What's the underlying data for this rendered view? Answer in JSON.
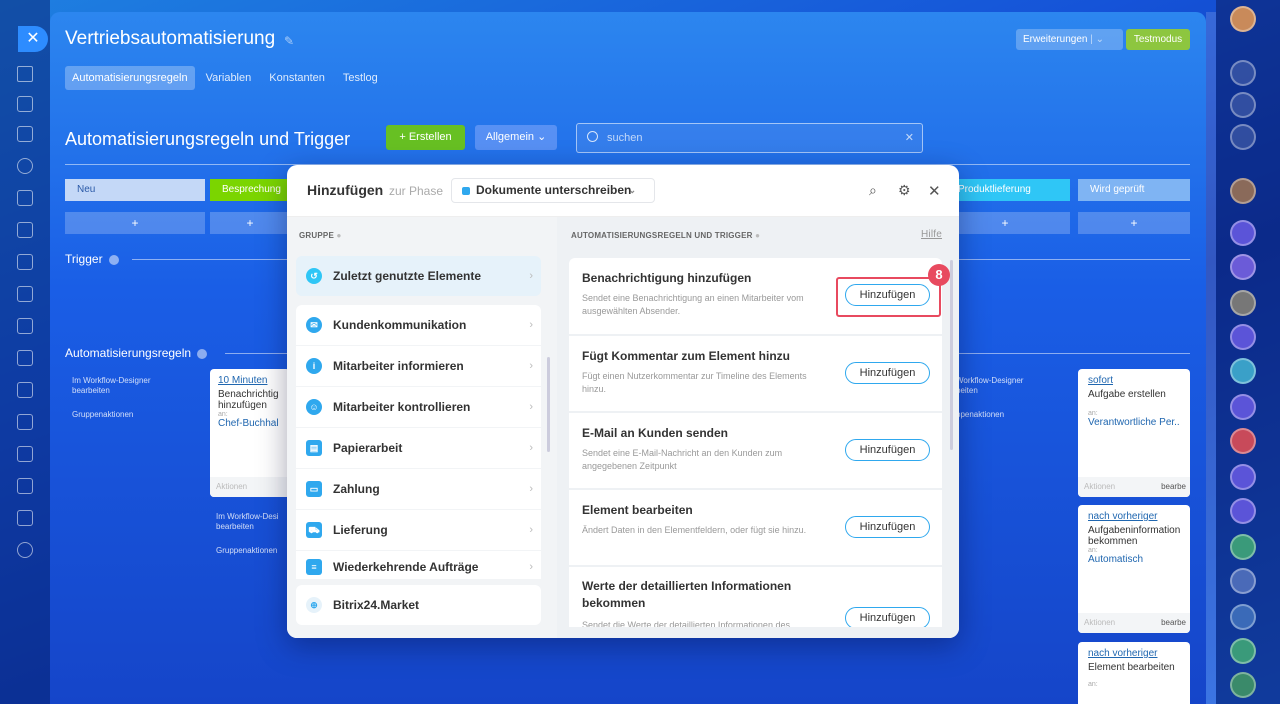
{
  "app": {
    "title": "Vertriebsautomatisierung",
    "erweiterungen": "Erweiterungen",
    "testmodus": "Testmodus"
  },
  "tabs": [
    "Automatisierungsregeln",
    "Variablen",
    "Konstanten",
    "Testlog"
  ],
  "section": {
    "title": "Automatisierungsregeln und Trigger",
    "create": "+ Erstellen",
    "allgemein": "Allgemein",
    "search_placeholder": "suchen"
  },
  "stages": [
    {
      "label": "Neu",
      "color": "#c4d8f7"
    },
    {
      "label": "Besprechung",
      "color": "#7bd500"
    },
    {
      "label": "Produktlieferung",
      "color": "#2fc6f6"
    },
    {
      "label": "Wird geprüft",
      "color": "#7fb4f3"
    }
  ],
  "labels": {
    "trigger": "Trigger",
    "automation": "Automatisierungsregeln",
    "workflow": "Im Workflow-Designer bearbeiten",
    "group_actions": "Gruppenaktionen",
    "workflow_short": "Im Workflow-Desi bearbeiten",
    "group_actions_short": "Gruppenaktionen",
    "workflow_right": "Workflow-Designer beiten",
    "group_right": "ppenaktionen"
  },
  "cards": {
    "c1": {
      "time": "10 Minuten",
      "title": "Benachrichtig hinzufügen",
      "an": "an:",
      "who": "Chef-Buchhal",
      "foot": "Aktionen"
    },
    "c2": {
      "time": "sofort",
      "title": "Aufgabe erstellen",
      "an": "an:",
      "who": "Verantwortliche Per..",
      "foot": "Aktionen",
      "foot2": "bearbe"
    },
    "c3": {
      "time": "nach vorheriger",
      "title": "Aufgabeninformation bekommen",
      "an": "an:",
      "who": "Automatisch",
      "foot": "Aktionen",
      "foot2": "bearbe"
    },
    "c4": {
      "time": "nach vorheriger",
      "title": "Element bearbeiten",
      "an": "an:"
    }
  },
  "modal": {
    "title": "Hinzufügen",
    "subtitle": "zur Phase",
    "phase": "Dokumente unterschreiben",
    "col_group": "GRUPPE",
    "col_rules": "AUTOMATISIERUNGSREGELN UND TRIGGER",
    "help": "Hilfe",
    "groups": [
      "Zuletzt genutzte Elemente",
      "Kundenkommunikation",
      "Mitarbeiter informieren",
      "Mitarbeiter kontrollieren",
      "Papierarbeit",
      "Zahlung",
      "Lieferung",
      "Wiederkehrende Aufträge",
      "Bitrix24.Market"
    ],
    "actions": [
      {
        "title": "Benachrichtigung hinzufügen",
        "desc": "Sendet eine Benachrichtigung an einen Mitarbeiter vom ausgewählten Absender."
      },
      {
        "title": "Fügt Kommentar zum Element hinzu",
        "desc": "Fügt einen Nutzerkommentar zur Timeline des Elements hinzu."
      },
      {
        "title": "E-Mail an Kunden senden",
        "desc": "Sendet eine E-Mail-Nachricht an den Kunden zum angegebenen Zeitpunkt"
      },
      {
        "title": "Element bearbeiten",
        "desc": "Ändert Daten in den Elementfeldern, oder fügt sie hinzu."
      },
      {
        "title": "Werte der detaillierten Informationen bekommen",
        "desc": "Sendet die Werte der detaillierten Informationen des"
      }
    ],
    "add_label": "Hinzufügen"
  },
  "badge": "8"
}
